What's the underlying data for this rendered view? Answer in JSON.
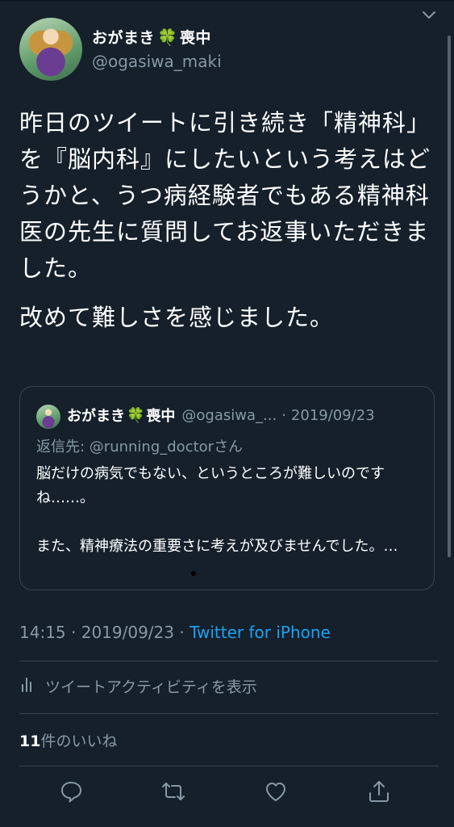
{
  "author": {
    "display_name": "おがまき",
    "emoji": "🍀",
    "suffix": "喪中",
    "handle": "@ogasiwa_maki"
  },
  "tweet": {
    "paragraphs": [
      "昨日のツイートに引き続き「精神科」を『脳内科』にしたいという考えはどうかと、うつ病経験者でもある精神科医の先生に質問してお返事いただきました。",
      "改めて難しさを感じました。"
    ]
  },
  "quote": {
    "display_name": "おがまき",
    "emoji": "🍀",
    "suffix": "喪中",
    "handle": "@ogasiwa_...",
    "separator": "·",
    "date": "2019/09/23",
    "reply_prefix": "返信先: ",
    "reply_mention": "@running_doctor",
    "reply_suffix": "さん",
    "body": [
      "脳だけの病気でもない、というところが難しいのですね……。",
      "また、精神療法の重要さに考えが及びませんでした。…"
    ]
  },
  "meta": {
    "time": "14:15",
    "separator": " · ",
    "date": "2019/09/23",
    "separator2": " · ",
    "source": "Twitter for iPhone"
  },
  "activity": {
    "label": "ツイートアクティビティを表示"
  },
  "likes": {
    "count": "11",
    "label": "件のいいね"
  },
  "colors": {
    "background": "#15202b",
    "accent": "#1da1f2",
    "muted": "#8899a6",
    "border": "#38444d"
  },
  "icons": {
    "menu": "chevron-down-icon",
    "activity": "bar-chart-icon",
    "reply": "reply-icon",
    "retweet": "retweet-icon",
    "like": "heart-icon",
    "share": "share-icon"
  }
}
